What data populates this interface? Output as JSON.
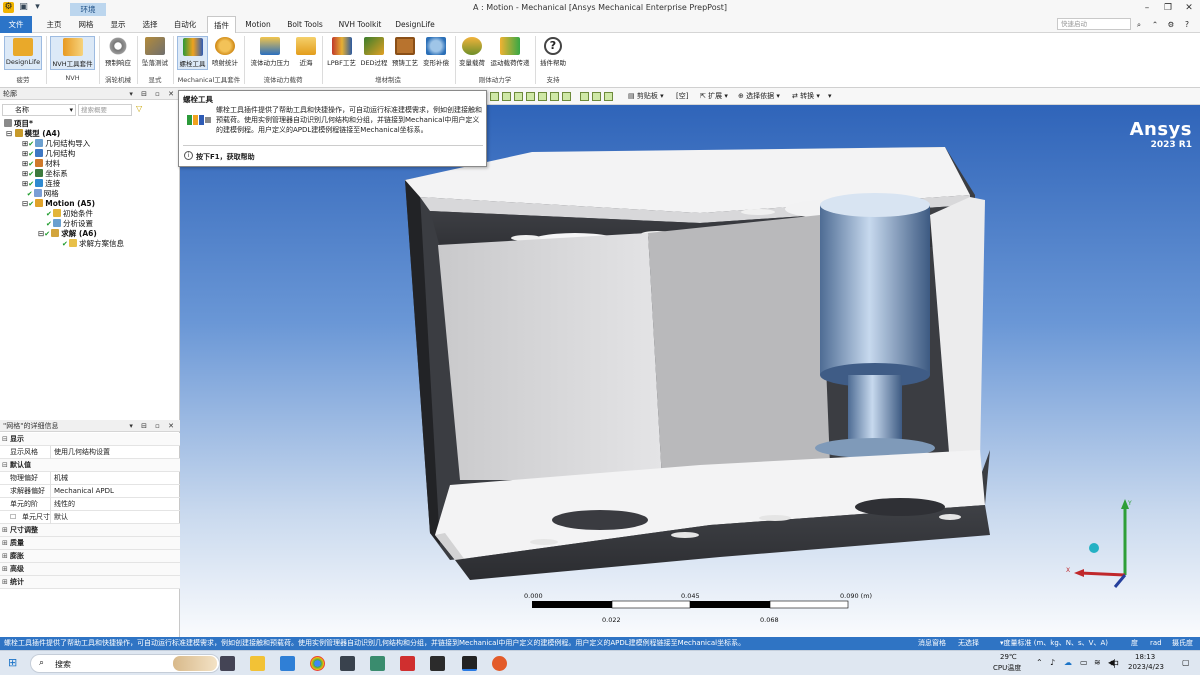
{
  "window": {
    "title": "A : Motion - Mechanical [Ansys Mechanical Enterprise PrepPost]",
    "env_tab": "环境"
  },
  "tabs": [
    "文件",
    "主页",
    "网格",
    "显示",
    "选择",
    "自动化",
    "插件",
    "Motion",
    "Bolt Tools",
    "NVH Toolkit",
    "DesignLife"
  ],
  "active_tab": "插件",
  "search_placeholder": "快速启动",
  "ribbon": {
    "buttons": [
      {
        "label": "DesignLife",
        "group": "疲劳"
      },
      {
        "label": "NVH工具套件",
        "group": "NVH"
      },
      {
        "label": "预制响应",
        "group": "涡轮机械"
      },
      {
        "label": "坠落测试",
        "group": "显式"
      },
      {
        "label": "螺栓工具",
        "group": "Mechanical工具套件"
      },
      {
        "label": "喷射统计",
        "group": "Mechanical工具套件"
      },
      {
        "label": "流体动力压力",
        "group": "流体动力载荷"
      },
      {
        "label": "近海",
        "group": "流体动力载荷"
      },
      {
        "label": "LPBF工艺",
        "group": "增材制造"
      },
      {
        "label": "DED过程",
        "group": "增材制造"
      },
      {
        "label": "预铸工艺",
        "group": "增材制造"
      },
      {
        "label": "变形补偿",
        "group": "增材制造"
      },
      {
        "label": "变量载荷",
        "group": "刚体动力学"
      },
      {
        "label": "运动载荷传递",
        "group": "刚体动力学"
      },
      {
        "label": "插件帮助",
        "group": "支持"
      }
    ],
    "groups": [
      "疲劳",
      "NVH",
      "涡轮机械",
      "显式",
      "Mechanical工具套件",
      "流体动力载荷",
      "增材制造",
      "刚体动力学",
      "支持"
    ]
  },
  "outline": {
    "title": "轮廓",
    "name_label": "名称",
    "search_placeholder": "搜索概要",
    "tree": [
      {
        "label": "项目*",
        "level": 0,
        "bold": true
      },
      {
        "label": "模型 (A4)",
        "level": 1,
        "bold": true
      },
      {
        "label": "几何结构导入",
        "level": 2
      },
      {
        "label": "几何结构",
        "level": 2
      },
      {
        "label": "材料",
        "level": 2
      },
      {
        "label": "坐标系",
        "level": 2
      },
      {
        "label": "连接",
        "level": 2
      },
      {
        "label": "网格",
        "level": 2
      },
      {
        "label": "Motion (A5)",
        "level": 2,
        "bold": true
      },
      {
        "label": "初始条件",
        "level": 3
      },
      {
        "label": "分析设置",
        "level": 3
      },
      {
        "label": "求解 (A6)",
        "level": 3,
        "bold": true
      },
      {
        "label": "求解方案信息",
        "level": 4
      }
    ]
  },
  "details": {
    "title": "\"网格\"的详细信息",
    "rows": [
      {
        "key": "显示",
        "section": true
      },
      {
        "key": "显示风格",
        "value": "使用几何结构设置"
      },
      {
        "key": "默认值",
        "section": true
      },
      {
        "key": "物理偏好",
        "value": "机械"
      },
      {
        "key": "求解器偏好",
        "value": "Mechanical APDL"
      },
      {
        "key": "单元的阶",
        "value": "线性的"
      },
      {
        "key": "单元尺寸",
        "value": "默认"
      },
      {
        "key": "尺寸调整",
        "section": true
      },
      {
        "key": "质量",
        "section": true
      },
      {
        "key": "膨胀",
        "section": true
      },
      {
        "key": "高级",
        "section": true
      },
      {
        "key": "统计",
        "section": true
      }
    ]
  },
  "graphics_toolbar": {
    "clipboard": "剪贴板",
    "empty": "[空]",
    "expand": "扩展",
    "select_by": "选择依据",
    "convert": "转换"
  },
  "tooltip": {
    "title": "螺栓工具",
    "body": "螺栓工具插件提供了帮助工具和快捷操作，可自动运行标准建模需求，例如创建接触和预载荷。使用实例管理器自动识别几何结构和分组，并链接到Mechanical中用户定义的建模例程。用户定义的APDL建模例程链接至Mechanical坐标系。",
    "f1": "按下F1，获取帮助"
  },
  "brand": {
    "name": "Ansys",
    "version": "2023 R1"
  },
  "scale": {
    "top": [
      "0.000",
      "0.045",
      "0.090 (m)"
    ],
    "bottom": [
      "0.022",
      "0.068"
    ]
  },
  "statusbar": {
    "message": "螺栓工具插件提供了帮助工具和快捷操作，可自动运行标准建模需求，例如创建接触和预载荷。使用实例管理器自动识别几何结构和分组，并链接到Mechanical中用户定义的建模例程。用户定义的APDL建模例程链接至Mechanical坐标系。",
    "messages": "消息窗格",
    "selection": "无选择",
    "units": "度量标准 (m、kg、N、s、V、A)",
    "angle": "度",
    "rad": "rad",
    "temp": "摄氏度"
  },
  "taskbar": {
    "search": "搜索",
    "weather_temp": "29℃",
    "weather_label": "CPU温度",
    "ime": "中",
    "time": "18:13",
    "date": "2023/4/23"
  },
  "colors": {
    "file_tab": "#2b74c8",
    "status_bar": "#2f74c4",
    "viewport_top": "#2f64b9",
    "viewport_bottom": "#ffffff"
  }
}
